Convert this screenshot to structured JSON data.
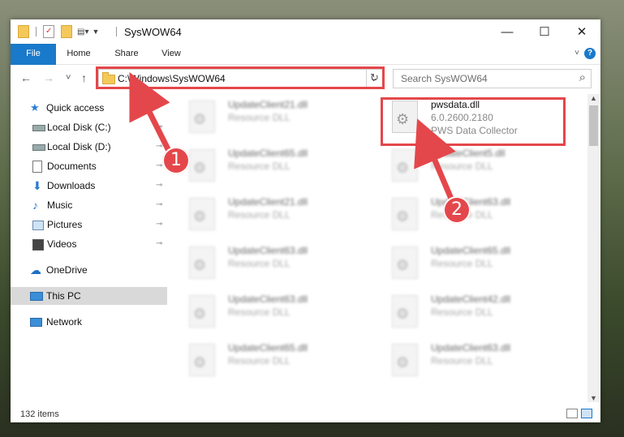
{
  "window": {
    "title": "SysWOW64",
    "controls": {
      "minimize": "—",
      "maximize": "☐",
      "close": "✕"
    }
  },
  "ribbon": {
    "tabs": [
      "File",
      "Home",
      "Share",
      "View"
    ],
    "help": "?"
  },
  "nav": {
    "back": "←",
    "forward": "→",
    "recent": "˅",
    "up": "↑",
    "address": "C:\\Windows\\SysWOW64",
    "dropdown": "⌄",
    "refresh": "↻",
    "search_placeholder": "Search SysWOW64",
    "search_icon": "⌕"
  },
  "sidebar": {
    "items": [
      {
        "label": "Quick access",
        "icon": "star-icon",
        "pinned": false
      },
      {
        "label": "Local Disk (C:)",
        "icon": "drive-icon",
        "pinned": true
      },
      {
        "label": "Local Disk (D:)",
        "icon": "drive-icon",
        "pinned": true
      },
      {
        "label": "Documents",
        "icon": "documents-icon",
        "pinned": true
      },
      {
        "label": "Downloads",
        "icon": "download-icon",
        "pinned": true
      },
      {
        "label": "Music",
        "icon": "music-icon",
        "pinned": true
      },
      {
        "label": "Pictures",
        "icon": "pictures-icon",
        "pinned": true
      },
      {
        "label": "Videos",
        "icon": "videos-icon",
        "pinned": true
      },
      {
        "label": "OneDrive",
        "icon": "cloud-icon",
        "pinned": false
      },
      {
        "label": "This PC",
        "icon": "computer-icon",
        "pinned": false
      },
      {
        "label": "Network",
        "icon": "network-icon",
        "pinned": false
      }
    ],
    "pin_glyph": "📌"
  },
  "files": [
    {
      "name": "UpdateClient21.dll",
      "desc": "Resource DLL"
    },
    {
      "name": "pwsdata.dll",
      "desc": "6.0.2600.2180",
      "desc2": "PWS Data Collector"
    },
    {
      "name": "UpdateClient65.dll",
      "desc": "Resource DLL"
    },
    {
      "name": "UpdateClient5.dll",
      "desc": "Resource DLL"
    },
    {
      "name": "UpdateClient21.dll",
      "desc": "Resource DLL"
    },
    {
      "name": "UpdateClient63.dll",
      "desc": "Resource DLL"
    },
    {
      "name": "UpdateClient63.dll",
      "desc": "Resource DLL"
    },
    {
      "name": "UpdateClient65.dll",
      "desc": "Resource DLL"
    },
    {
      "name": "UpdateClient63.dll",
      "desc": "Resource DLL"
    },
    {
      "name": "UpdateClient42.dll",
      "desc": "Resource DLL"
    },
    {
      "name": "UpdateClient65.dll",
      "desc": "Resource DLL"
    },
    {
      "name": "UpdateClient63.dll",
      "desc": "Resource DLL"
    }
  ],
  "status": {
    "count": "132 items"
  },
  "annotations": {
    "badge1": "1",
    "badge2": "2",
    "color": "#e4474b"
  }
}
